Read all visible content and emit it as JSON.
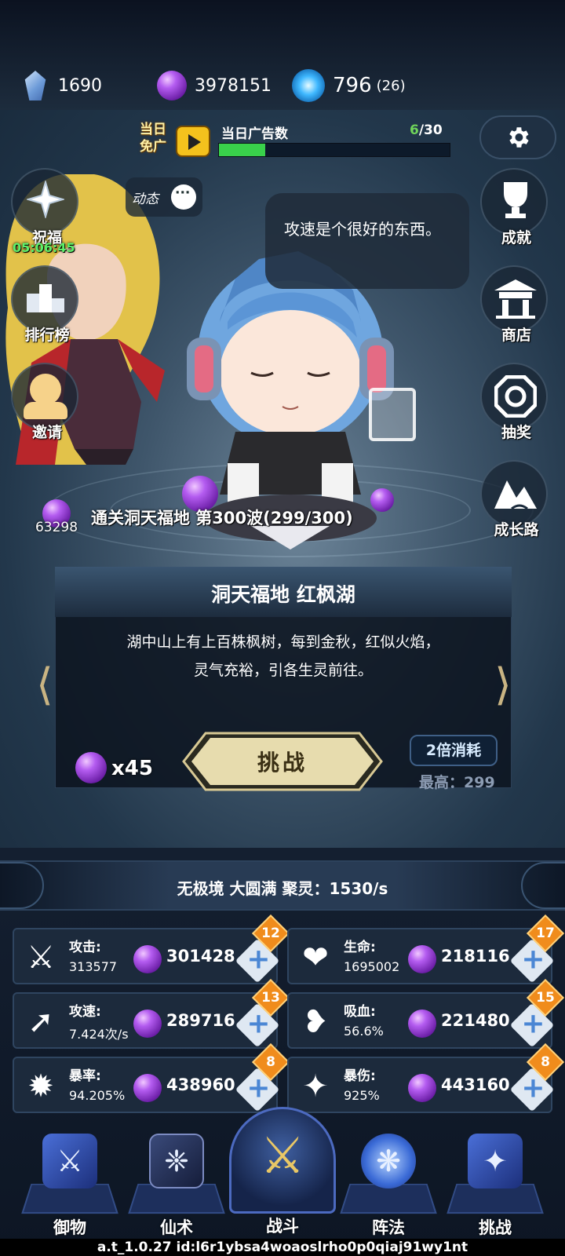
{
  "resources": [
    {
      "icon": "crystal-icon",
      "value": "1690"
    },
    {
      "icon": "spirit-orb-icon",
      "value": "3978151"
    },
    {
      "icon": "lightning-gem-icon",
      "value": "796",
      "extra": "(26)"
    }
  ],
  "ad": {
    "badge": "当日免广",
    "label": "当日广告数",
    "current": "6",
    "total": "/30",
    "progress": 0.2
  },
  "left_menu": [
    {
      "label": "祝福",
      "timer": "05:06:45",
      "icon": "blessing-star-icon"
    },
    {
      "label": "排行榜",
      "icon": "podium-icon"
    },
    {
      "label": "邀请",
      "icon": "invite-user-icon"
    }
  ],
  "right_menu": [
    {
      "label": "成就",
      "icon": "trophy-icon"
    },
    {
      "label": "商店",
      "icon": "shop-pavilion-icon"
    },
    {
      "label": "抽奖",
      "icon": "lottery-icon"
    },
    {
      "label": "成长路",
      "icon": "mountain-path-icon"
    }
  ],
  "feed_button": "动态",
  "speech": "攻速是个很好的东西。",
  "wave": {
    "count": "63298",
    "text": "通关洞天福地 第300波(299/300)"
  },
  "stage": {
    "title": "洞天福地 红枫湖",
    "description_line1": "湖中山上有上百株枫树，每到金秋，红似火焰，",
    "description_line2": "灵气充裕，引各生灵前往。",
    "challenge": "挑战",
    "cost": "x45",
    "double": "2倍消耗",
    "best": "最高：299"
  },
  "realm": "无极境 大圆满 聚灵：1530/s",
  "stats": [
    {
      "name": "攻击:",
      "value": "313577",
      "cost": "301428",
      "level": "12",
      "icon": "sword-icon"
    },
    {
      "name": "生命:",
      "value": "1695002",
      "cost": "218116",
      "level": "17",
      "icon": "heart-icon"
    },
    {
      "name": "攻速:",
      "value": "7.424次/s",
      "cost": "289716",
      "level": "13",
      "icon": "attack-speed-icon"
    },
    {
      "name": "吸血:",
      "value": "56.6%",
      "cost": "221480",
      "level": "15",
      "icon": "lifesteal-icon"
    },
    {
      "name": "暴率:",
      "value": "94.205%",
      "cost": "438960",
      "level": "8",
      "icon": "crit-rate-icon"
    },
    {
      "name": "暴伤:",
      "value": "925%",
      "cost": "443160",
      "level": "8",
      "icon": "crit-damage-icon"
    }
  ],
  "nav": [
    {
      "label": "御物",
      "icon": "artifact-icon"
    },
    {
      "label": "仙术",
      "icon": "spell-card-icon"
    },
    {
      "label": "战斗",
      "icon": "battle-trident-icon"
    },
    {
      "label": "阵法",
      "icon": "formation-icon"
    },
    {
      "label": "挑战",
      "icon": "challenge-icon"
    }
  ],
  "footer": "a.t_1.0.27 id:l6r1ybsa4woaoslrho0p0qiaj91wy1nt"
}
